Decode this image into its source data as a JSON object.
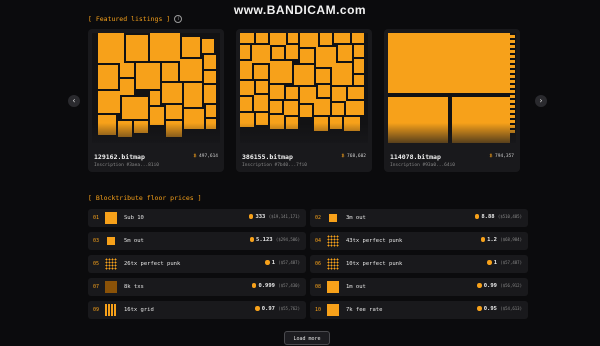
{
  "watermark": "www.BANDICAM.com",
  "featured": {
    "title": "[ Featured listings ]",
    "info_icon": "i",
    "prev_icon": "‹",
    "next_icon": "›",
    "cards": [
      {
        "name": "129162.bitmap",
        "price": "497,614",
        "inscription": "Inscription #3aea...81i0"
      },
      {
        "name": "386155.bitmap",
        "price": "768,602",
        "inscription": "Inscription #7b40...7fi0"
      },
      {
        "name": "114078.bitmap",
        "price": "794,357",
        "inscription": "Inscription #93a0...64i0"
      }
    ]
  },
  "floor": {
    "title": "[ Blocktribute floor prices ]",
    "items": [
      {
        "rank": "01",
        "name": "Sub 10",
        "value": "333",
        "usd": "($19,141,171)"
      },
      {
        "rank": "02",
        "name": "3m out",
        "value": "8.88",
        "usd": "($510,485)"
      },
      {
        "rank": "03",
        "name": "5m out",
        "value": "5.123",
        "usd": "($294,506)"
      },
      {
        "rank": "04",
        "name": "43tx perfect punk",
        "value": "1.2",
        "usd": "($68,984)"
      },
      {
        "rank": "05",
        "name": "26tx perfect punk",
        "value": "1",
        "usd": "($57,487)"
      },
      {
        "rank": "06",
        "name": "10tx perfect punk",
        "value": "1",
        "usd": "($57,487)"
      },
      {
        "rank": "07",
        "name": "8k txs",
        "value": "0.999",
        "usd": "($57,430)"
      },
      {
        "rank": "08",
        "name": "1m out",
        "value": "0.99",
        "usd": "($56,912)"
      },
      {
        "rank": "09",
        "name": "16tx grid",
        "value": "0.97",
        "usd": "($55,762)"
      },
      {
        "rank": "10",
        "name": "7k fee rate",
        "value": "0.95",
        "usd": "($54,613)"
      }
    ]
  },
  "load_more_label": "Load more",
  "colors": {
    "accent": "#f7a11a",
    "background": "#0b0b0d",
    "card": "#19191c"
  }
}
